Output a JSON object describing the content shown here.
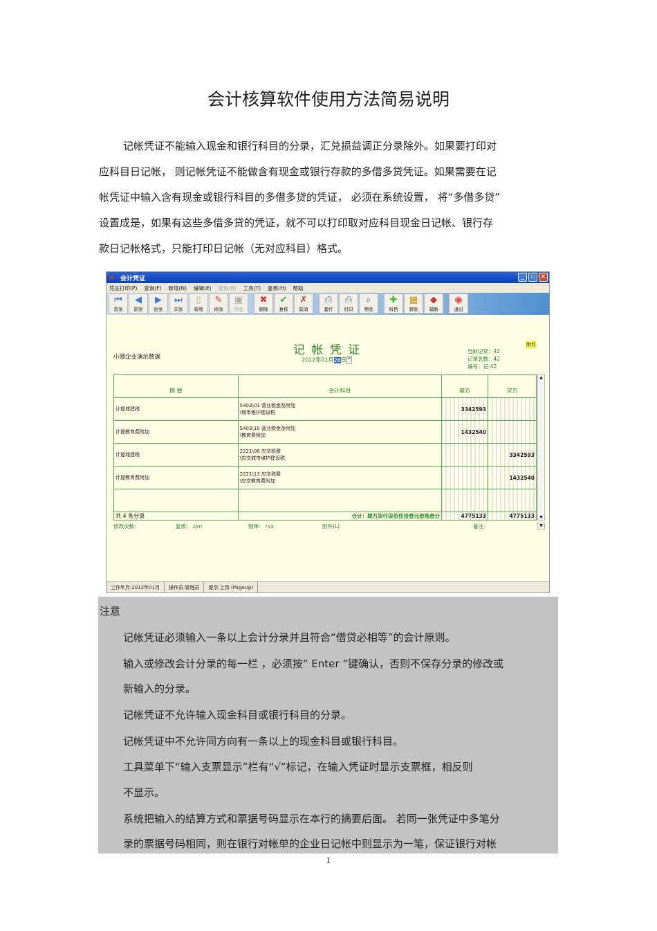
{
  "title": "会计核算软件使用方法简易说明",
  "paragraph": [
    "记帐凭证不能输入现金和银行科目的分录，汇兑损益调正分录除外。如果要打印对",
    "应科目日记帐，   则记帐凭证不能做含有现金或银行存款的多借多贷凭证。如果需要在记",
    "帐凭证中输入含有现金或银行科目的多借多贷的凭证，      必须在系统设置，   将“多借多贷”",
    "设置成是，如果有这些多借多贷的凭证，就不可以打印取对应科目现金日记帐、银行存",
    "款日记帐格式，只能打印日记帐（无对应科目）格式。"
  ],
  "app": {
    "window_title": "会计凭证",
    "menu": [
      "凭证打印(P)",
      "查询(F)",
      "新增(N)",
      "编辑(E)",
      "复制(B)",
      "工具(T)",
      "复核(H)",
      "帮助"
    ],
    "toolbar": [
      [
        "首张",
        "前张",
        "后张",
        "末张",
        "新增",
        "修改",
        "存盘"
      ],
      [
        "删除",
        "复核",
        "取消"
      ],
      [
        "套打",
        "打印",
        "预览"
      ],
      [
        "科目",
        "转账",
        "辅助"
      ],
      [
        "退出"
      ]
    ],
    "company": "小微企业演示数据",
    "voucher_title": "记 帐 凭 证",
    "date_prefix": "2012年01月",
    "date_day": "26",
    "date_suffix": "日",
    "attachment_badge": "附件",
    "current_record": "当前记录：42",
    "total_records": "记录总数：42",
    "number": "编号：记-42",
    "headers": [
      "摘 要",
      "会计科目",
      "借方",
      "贷方"
    ],
    "rows": [
      {
        "summary": "计提城建税",
        "account1": "5403\\03 营业税金及附加",
        "account2": "\\城市维护建设税",
        "debit": "3342593",
        "credit": ""
      },
      {
        "summary": "计提教育费附加",
        "account1": "5403\\10 营业税金及附加",
        "account2": "\\教育费附加",
        "debit": "1432540",
        "credit": ""
      },
      {
        "summary": "计提城建税",
        "account1": "2221\\08 应交税费",
        "account2": "\\应交城市维护建设税",
        "debit": "",
        "credit": "3342593"
      },
      {
        "summary": "计提教育费附加",
        "account1": "2221\\13 应交税费",
        "account2": "\\应交教育费附加",
        "debit": "",
        "credit": "1432540"
      }
    ],
    "entry_count": "共 4 条分录",
    "total_label": "合计：肆万柒仟柒佰伍拾叁元叁角叁分",
    "total_debit": "4775133",
    "total_credit": "4775133",
    "footer": {
      "edits": "修改次数:",
      "review": "复核： zjm",
      "maker": "制单： rvx",
      "attach": "附件(L)",
      "remark": "备注："
    },
    "status": [
      "工作年月:2012年01月",
      "操作员:管理员",
      "提示:上页 (PageUp)"
    ]
  },
  "notes": {
    "heading": "注意",
    "lines": [
      "记帐凭证必须输入一条以上会计分录并且符合“借贷必相等”的会计原则。",
      "输入或修改会计分录的每一栏    ，必须按“ Enter ”键确认，否则不保存分录的修改或",
      "新输入的分录。",
      "记帐凭证不允许输入现金科目或银行科目的分录。",
      "记帐凭证中不允许同方向有一条以上的现金科目或银行科目。",
      "工具菜单下“输入支票显示”栏有“√”标记，在输入凭证时显示支票框，相反则",
      "不显示。",
      "系统把输入的结算方式和票据号码显示在本行的摘要后面。      若同一张凭证中多笔分",
      "录的票据号码相同，则在银行对帐单的企业日记帐中则显示为一笔，保证银行对帐"
    ]
  },
  "page_number": "1"
}
